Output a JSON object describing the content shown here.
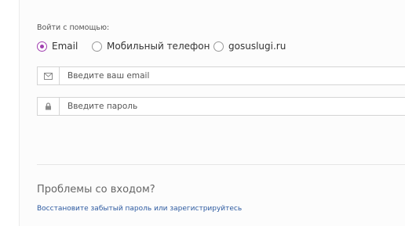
{
  "login": {
    "heading": "Войти с помощью:",
    "methods": [
      {
        "label": "Email",
        "checked": true
      },
      {
        "label": "Мобильный телефон",
        "checked": false
      },
      {
        "label": "gosuslugi.ru",
        "checked": false
      }
    ],
    "email_placeholder": "Введите ваш email",
    "password_placeholder": "Введите пароль",
    "accent_color": "#a13fb0"
  },
  "help": {
    "title": "Проблемы со входом?",
    "restore_link": "Восстановите забытый пароль или зарегистрируйтесь"
  }
}
